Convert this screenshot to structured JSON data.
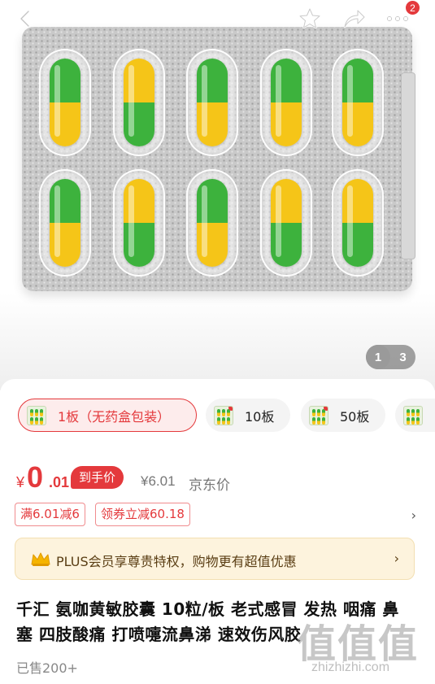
{
  "header": {
    "notification_count": "2",
    "icons": [
      "back-arrow-icon",
      "star-icon",
      "share-icon",
      "more-icon"
    ]
  },
  "gallery": {
    "current_index": "1",
    "total": "3",
    "capsule_colors": {
      "green": "#3db23d",
      "yellow": "#f5c518"
    }
  },
  "specs": [
    {
      "label": "1板（无药盒包装）",
      "selected": true
    },
    {
      "label": "10板",
      "selected": false
    },
    {
      "label": "50板",
      "selected": false
    }
  ],
  "price": {
    "currency": "¥",
    "integer": "0",
    "decimal": ".01",
    "hand_price_tag": "到手价",
    "jd_price": "¥6.01",
    "jd_label": "京东价"
  },
  "coupons": [
    {
      "label": "满6.01减6"
    },
    {
      "label": "领券立减60.18"
    }
  ],
  "plus": {
    "text": "PLUS会员享尊贵特权，购物更有超值优惠"
  },
  "product": {
    "title": "千汇 氨咖黄敏胶囊 10粒/板 老式感冒 发热 咽痛 鼻塞 四肢酸痛 打喷嚏流鼻涕 速效伤风胶",
    "sold": "已售200+"
  },
  "watermark": {
    "glyph": "值值值",
    "url": "zhizhizhi.com"
  },
  "colors": {
    "accent": "#e4393c",
    "plus_bg": "#fdf3dd",
    "plus_text": "#5a3e14"
  }
}
